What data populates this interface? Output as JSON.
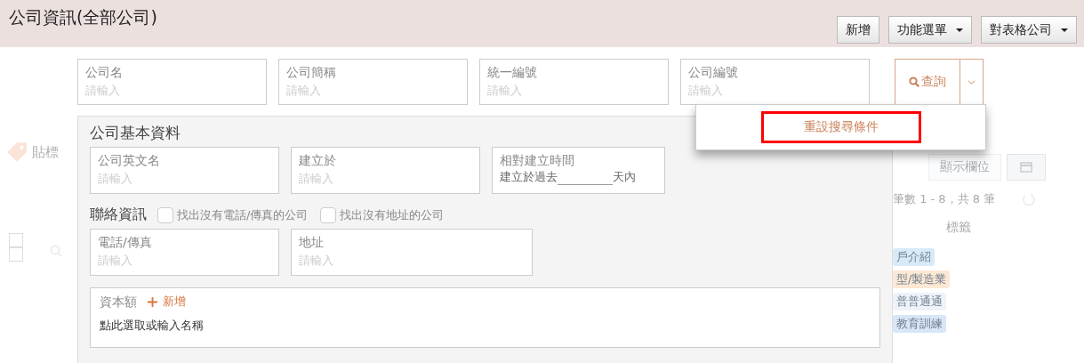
{
  "header": {
    "title": "公司資訊(全部公司)",
    "buttons": [
      {
        "label": "新增",
        "kind": "plain"
      },
      {
        "label": "功能選單",
        "kind": "dropdown"
      },
      {
        "label": "對表格公司",
        "kind": "dropdown"
      }
    ]
  },
  "search": {
    "fields": [
      {
        "label": "公司名",
        "placeholder": "請輸入"
      },
      {
        "label": "公司簡稱",
        "placeholder": "請輸入"
      },
      {
        "label": "統一編號",
        "placeholder": "請輸入"
      },
      {
        "label": "公司編號",
        "placeholder": "請輸入"
      }
    ],
    "query_button": "查詢",
    "menu": {
      "expanded": true,
      "items": [
        {
          "label": "重設搜尋條件",
          "highlighted": true
        }
      ]
    }
  },
  "panel": {
    "title": "公司基本資料",
    "fields": [
      {
        "kind": "input",
        "label": "公司英文名",
        "placeholder": "請輸入"
      },
      {
        "kind": "input",
        "label": "建立於",
        "placeholder": "請輸入"
      },
      {
        "kind": "relative",
        "label": "相對建立時間",
        "prefix": "建立於過去",
        "suffix": "天內"
      }
    ],
    "contact": {
      "title": "聯絡資訊",
      "options": [
        {
          "label": "找出沒有電話/傳真的公司",
          "checked": false
        },
        {
          "label": "找出沒有地址的公司",
          "checked": false
        }
      ],
      "fields": [
        {
          "label": "電話/傳真",
          "placeholder": "請輸入"
        },
        {
          "label": "地址",
          "placeholder": "請輸入"
        }
      ]
    },
    "capital": {
      "label": "資本額",
      "add": "新增",
      "placeholder": "點此選取或輸入名稱"
    }
  },
  "background": {
    "tag_button": "貼標",
    "checkboxes": [
      {
        "checked": false
      },
      {
        "checked": false
      }
    ],
    "columns_button": "顯示欄位",
    "count": "筆數 1 - 8，共 8 筆",
    "column_header": "標籤",
    "tags": [
      {
        "label": "戶介紹",
        "color": "#d9eaf7"
      },
      {
        "label": "型/製造業",
        "color": "#fde8d4"
      },
      {
        "label": "普普通通",
        "color": "#eef3f9"
      },
      {
        "label": "教育訓練",
        "color": "#d8e6f6"
      }
    ]
  }
}
